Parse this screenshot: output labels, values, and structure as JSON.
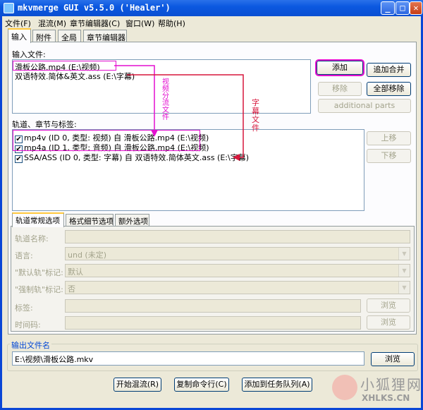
{
  "window": {
    "title": "mkvmerge GUI v5.5.0 ('Healer')",
    "minimize": "_",
    "maximize": "□",
    "close": "✕"
  },
  "menu": [
    "文件(F)",
    "混流(M)",
    "章节编辑器(C)",
    "窗口(W)",
    "帮助(H)"
  ],
  "tabs": [
    "输入",
    "附件",
    "全局",
    "章节编辑器"
  ],
  "input": {
    "files_label": "输入文件:",
    "files": [
      "滑板公路.mp4 (E:\\视频)",
      "双语特效.简体&英文.ass (E:\\字幕)"
    ],
    "add": "添加",
    "append": "追加合并",
    "remove": "移除",
    "remove_all": "全部移除",
    "additional_parts": "additional parts"
  },
  "tracks": {
    "label": "轨道、章节与标签:",
    "items": [
      "mp4v (ID 0, 类型: 视频) 自 滑板公路.mp4 (E:\\视频)",
      "mp4a (ID 1, 类型: 音频) 自 滑板公路.mp4 (E:\\视频)",
      "SSA/ASS (ID 0, 类型: 字幕) 自 双语特效.简体英文.ass (E:\\字幕)"
    ],
    "checked": [
      "✔",
      "✔",
      "✔"
    ],
    "up": "上移",
    "down": "下移"
  },
  "annotations": {
    "video_split": [
      "视",
      "频",
      "分",
      "流",
      "文",
      "件"
    ],
    "subtitle_file": [
      "字",
      "幕",
      "文",
      "件"
    ]
  },
  "subtabs": [
    "轨道常规选项",
    "格式细节选项",
    "额外选项"
  ],
  "track_options": {
    "name_label": "轨道名称:",
    "language_label": "语言:",
    "language_value": "und (未定)",
    "default_label": "\"默认轨\"标记:",
    "default_value": "默认",
    "forced_label": "\"强制轨\"标记:",
    "forced_value": "否",
    "tags_label": "标签:",
    "timecodes_label": "时间码:",
    "browse": "浏览",
    "dropdown_arrow": "▼"
  },
  "output": {
    "group_label": "输出文件名",
    "filename": "E:\\视频\\滑板公路.mkv",
    "browse": "浏览"
  },
  "actions": {
    "start": "开始混流(R)",
    "copy_cmd": "复制命令行(C)",
    "add_job": "添加到任务队列(A)"
  },
  "watermark": {
    "cn": "小狐狸网",
    "en": "XHLKS.CN"
  },
  "colors": {
    "accent": "#e40fd0",
    "arrow_red": "#d7173c",
    "title_blue": "#0a4fd2"
  }
}
